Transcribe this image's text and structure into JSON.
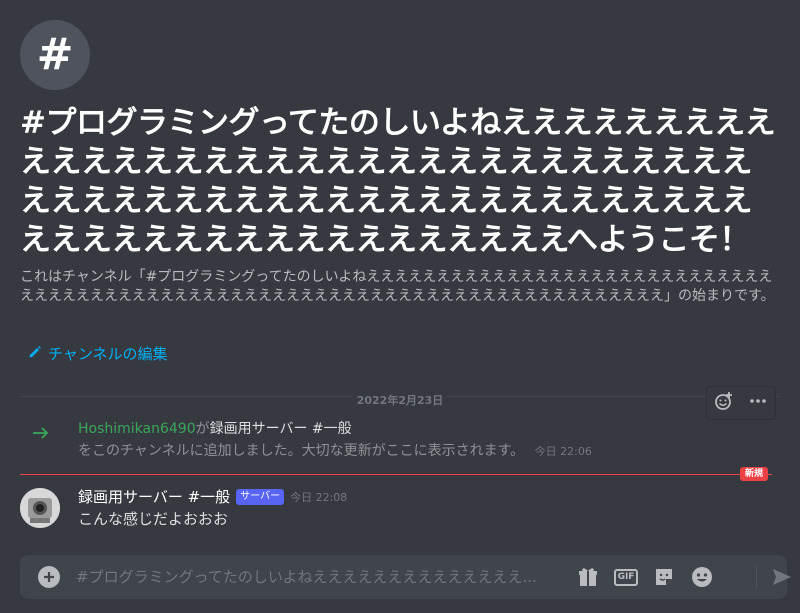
{
  "welcome": {
    "channel_glyph": "#",
    "title": "#プログラミングってたのしいよねえええええええええええええええええええええええええええええええええええええええええええええええええええええええええええええええええええええええええええへようこそ！",
    "subtitle": "これはチャンネル「#プログラミングってたのしいよねえええええええええええええええええええええええええええええええええええええええええええええええええええええええええええええええええええええええええええ」の始まりです。",
    "edit_label": "チャンネルの編集"
  },
  "date_divider": "2022年2月23日",
  "system_message": {
    "user": "Hoshimikan6490",
    "connector": "が",
    "source": "録画用サーバー #一般",
    "text": "をこのチャンネルに追加しました。大切な更新がここに表示されます。",
    "time": "今日 22:06"
  },
  "new_badge": "新規",
  "message": {
    "author": "録画用サーバー #一般",
    "badge": "サーバー",
    "time": "今日 22:08",
    "body": "こんな感じだよおおお"
  },
  "composer": {
    "placeholder": "#プログラミングってたのしいよねええええええええええええええ...",
    "gif_label": "GIF"
  },
  "colors": {
    "background": "#36393f",
    "link": "#00aff4",
    "username": "#3ba55c",
    "new_divider": "#ed4245",
    "server_badge": "#5865f2"
  }
}
